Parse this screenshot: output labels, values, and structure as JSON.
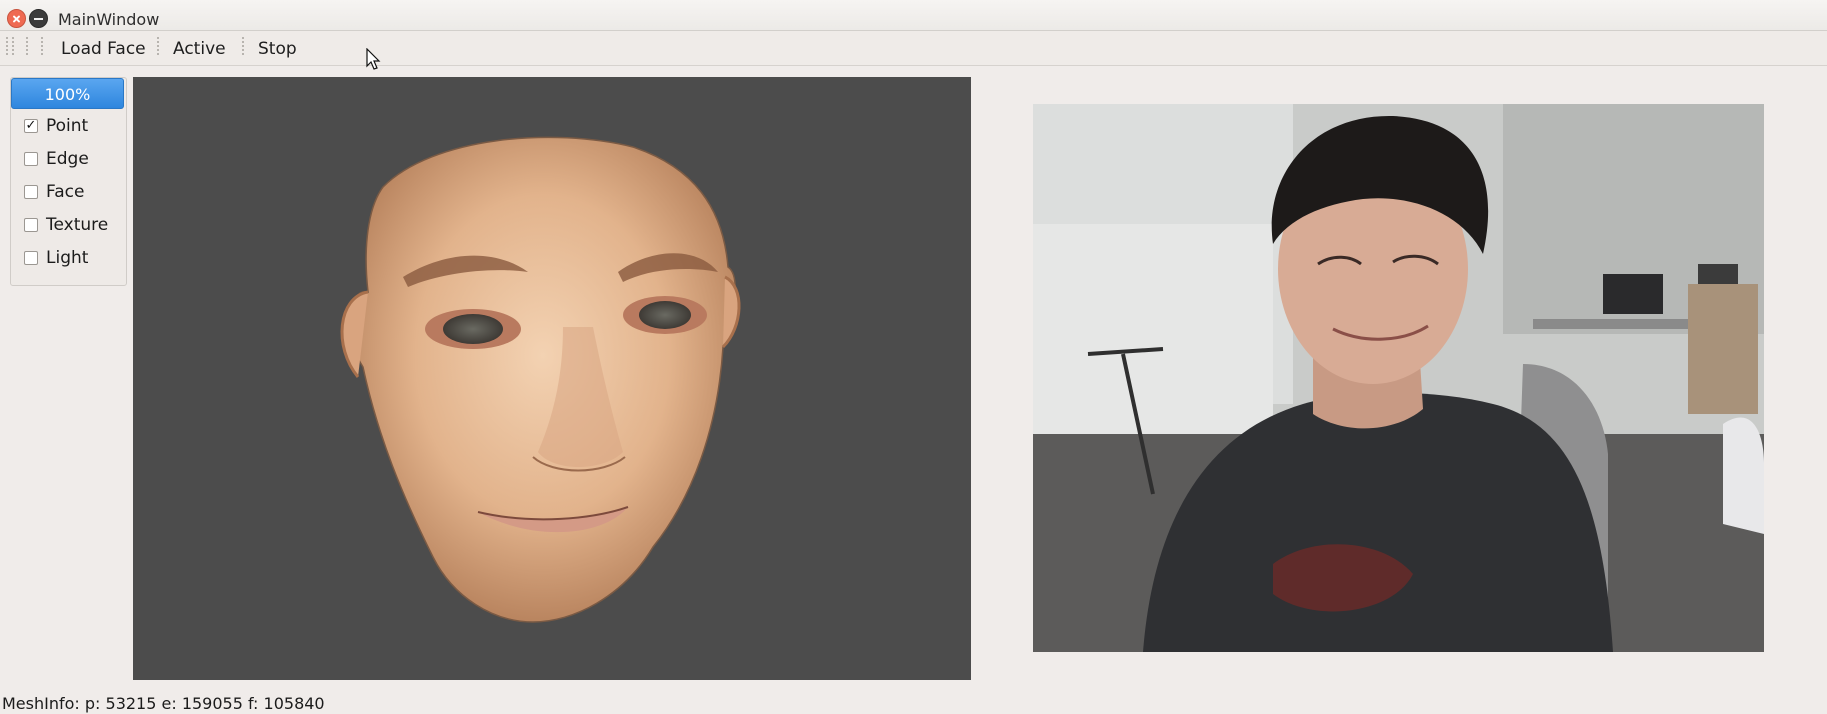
{
  "window": {
    "title": "MainWindow"
  },
  "toolbar": {
    "load_face_label": "Load Face",
    "active_label": "Active",
    "stop_label": "Stop"
  },
  "side_panel": {
    "zoom_label": "100%",
    "options": [
      {
        "label": "Point",
        "checked": true
      },
      {
        "label": "Edge",
        "checked": false
      },
      {
        "label": "Face",
        "checked": false
      },
      {
        "label": "Texture",
        "checked": false
      },
      {
        "label": "Light",
        "checked": false
      }
    ]
  },
  "status_bar": {
    "mesh_info": "MeshInfo: p: 53215 e: 159055 f: 105840"
  },
  "colors": {
    "viewport_bg": "#4c4c4c",
    "accent": "#2e86de",
    "window_bg": "#f0ecea"
  }
}
